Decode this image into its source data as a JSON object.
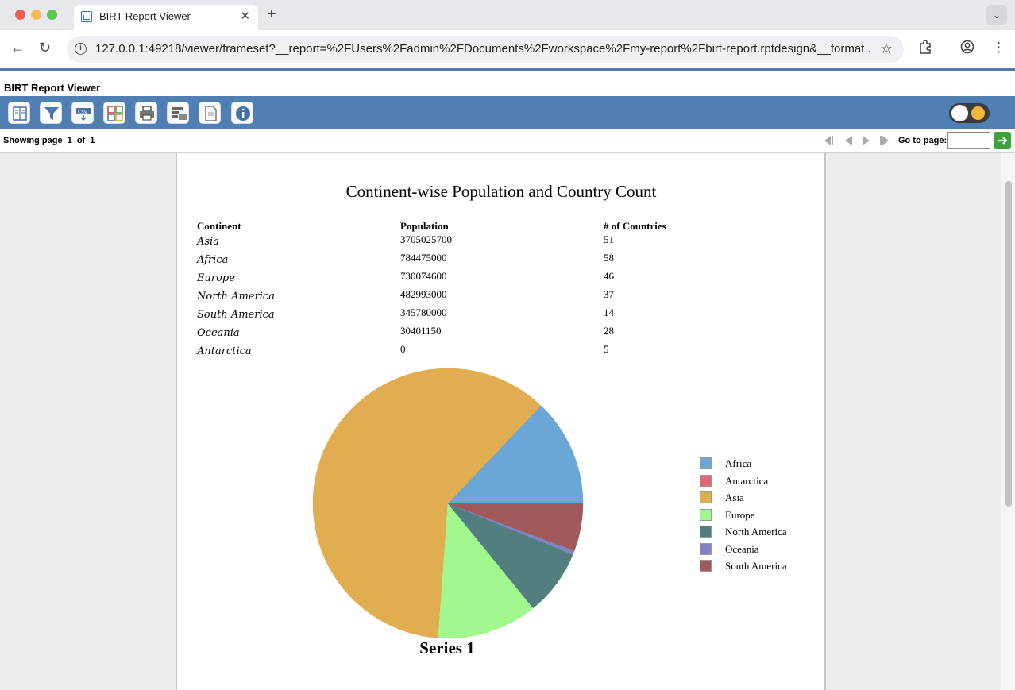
{
  "browser": {
    "tab_title": "BIRT Report Viewer",
    "url": "127.0.0.1:49218/viewer/frameset?__report=%2FUsers%2Fadmin%2FDocuments%2Fworkspace%2Fmy-report%2Fbirt-report.rptdesign&__format..."
  },
  "viewer": {
    "title": "BIRT Report Viewer",
    "toolbar_icons": [
      "toc-icon",
      "parameters-icon",
      "export-data-icon",
      "export-report-icon",
      "print-icon",
      "print-server-icon",
      "report-icon",
      "info-icon"
    ],
    "page_bar": {
      "showing_label": "Showing page",
      "current_page": "1",
      "of_label": "of",
      "total_pages": "1",
      "goto_label": "Go to page:",
      "goto_value": ""
    }
  },
  "report": {
    "title": "Continent-wise Population and Country Count",
    "columns": [
      "Continent",
      "Population",
      "# of Countries"
    ],
    "rows": [
      {
        "continent": "Asia",
        "population": "3705025700",
        "countries": "51"
      },
      {
        "continent": "Africa",
        "population": "784475000",
        "countries": "58"
      },
      {
        "continent": "Europe",
        "population": "730074600",
        "countries": "46"
      },
      {
        "continent": "North America",
        "population": "482993000",
        "countries": "37"
      },
      {
        "continent": "South America",
        "population": "345780000",
        "countries": "14"
      },
      {
        "continent": "Oceania",
        "population": "30401150",
        "countries": "28"
      },
      {
        "continent": "Antarctica",
        "population": "0",
        "countries": "5"
      }
    ]
  },
  "chart_data": {
    "type": "pie",
    "title": "",
    "series_label": "Series 1",
    "legend_position": "right",
    "slices": [
      {
        "label": "Africa",
        "value": 784475000,
        "color": "#6aa6d6"
      },
      {
        "label": "Antarctica",
        "value": 0,
        "color": "#e0667a"
      },
      {
        "label": "Asia",
        "value": 3705025700,
        "color": "#e0ad50"
      },
      {
        "label": "Europe",
        "value": 730074600,
        "color": "#a2f78e"
      },
      {
        "label": "North America",
        "value": 482993000,
        "color": "#517e7e"
      },
      {
        "label": "Oceania",
        "value": 30401150,
        "color": "#8284c4"
      },
      {
        "label": "South America",
        "value": 345780000,
        "color": "#a05a5a"
      }
    ],
    "draw_order": [
      "Africa",
      "Asia",
      "Europe",
      "North America",
      "Oceania",
      "South America"
    ]
  },
  "colors": {
    "toolbar": "#5080b3",
    "accent_rule": "#4f7cab",
    "goto_button": "#3da23a"
  }
}
